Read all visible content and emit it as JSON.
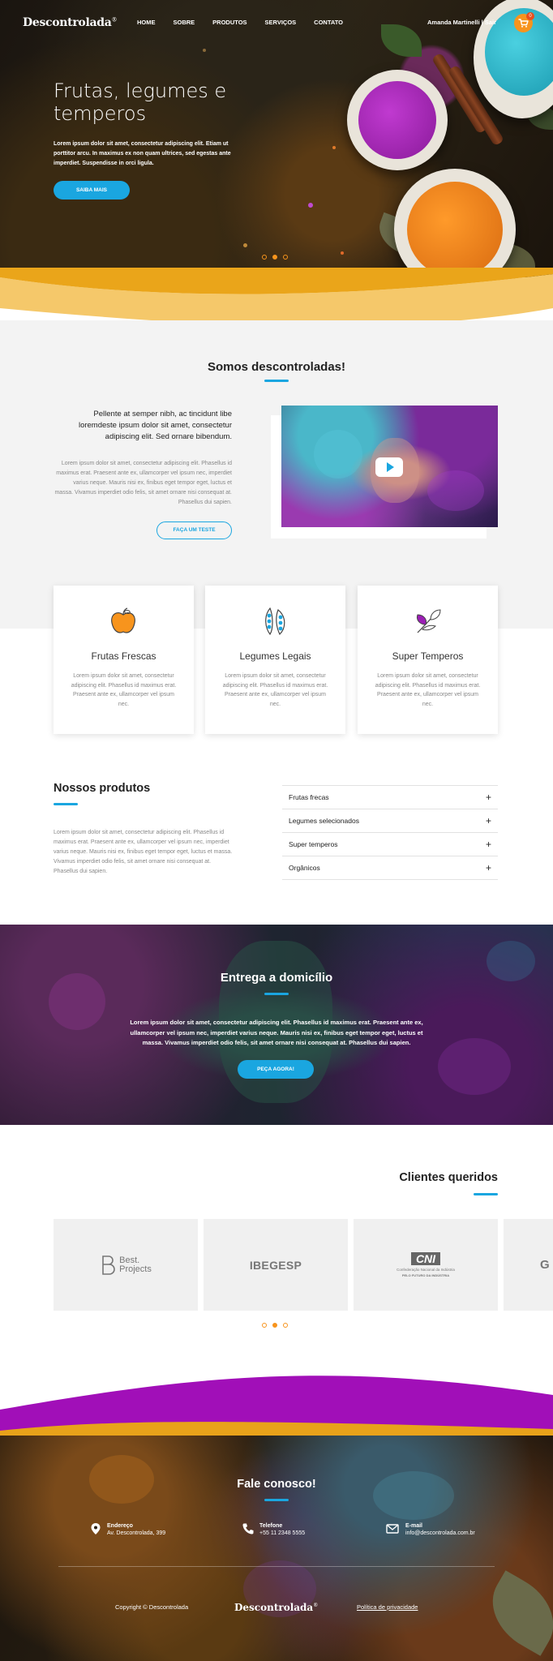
{
  "brand": {
    "logo": "Descontrolada",
    "logo_mark": "®"
  },
  "nav": {
    "items": [
      "HOME",
      "SOBRE",
      "PRODUTOS",
      "SERVIÇOS",
      "CONTATO"
    ]
  },
  "header": {
    "user_text": "Amanda Martinelli  |  Sair",
    "cart_count": "0"
  },
  "hero": {
    "title": "Frutas, legumes e temperos",
    "text": "Lorem ipsum dolor sit amet, consectetur adipiscing elit. Etiam ut porttitor arcu. In maximus ex non quam ultrices, sed egestas ante imperdiet. Suspendisse in orci ligula.",
    "button": "SAIBA MAIS",
    "slider": {
      "count": 3,
      "active": 2
    }
  },
  "about": {
    "title": "Somos descontroladas!",
    "lead": "Pellente at semper nibh, ac tincidunt libe loremdeste ipsum dolor sit amet, consectetur adipiscing elit. Sed ornare bibendum.",
    "body": "Lorem ipsum dolor sit amet, consectetur adipiscing elit. Phasellus id maximus erat. Praesent ante ex, ullamcorper vel ipsum nec, imperdiet varius neque. Mauris nisi ex, finibus eget tempor eget, luctus et massa. Vivamus imperdiet odio felis, sit amet ornare nisi consequat at. Phasellus dui sapien.",
    "button": "FAÇA UM TESTE"
  },
  "features": [
    {
      "icon": "apple-icon",
      "title": "Frutas Frescas",
      "text": "Lorem ipsum dolor sit amet, consectetur adipiscing elit. Phasellus id maximus erat. Praesent ante ex, ullamcorper vel ipsum nec."
    },
    {
      "icon": "peapod-icon",
      "title": "Legumes Legais",
      "text": "Lorem ipsum dolor sit amet, consectetur adipiscing elit. Phasellus id maximus erat. Praesent ante ex, ullamcorper vel ipsum nec."
    },
    {
      "icon": "herb-icon",
      "title": "Super Temperos",
      "text": "Lorem ipsum dolor sit amet, consectetur adipiscing elit. Phasellus id maximus erat. Praesent ante ex, ullamcorper vel ipsum nec."
    }
  ],
  "products": {
    "title": "Nossos produtos",
    "body": "Lorem ipsum dolor sit amet, consectetur adipiscing elit. Phasellus id maximus erat. Praesent ante ex, ullamcorper vel ipsum nec, imperdiet varius neque. Mauris nisi ex, finibus eget tempor eget, luctus et massa. Vivamus imperdiet odio felis, sit amet ornare nisi consequat at. Phasellus dui sapien.",
    "accordion": [
      "Frutas frecas",
      "Legumes selecionados",
      "Super temperos",
      "Orgânicos"
    ]
  },
  "delivery": {
    "title": "Entrega a domicílio",
    "text": "Lorem ipsum dolor sit amet, consectetur adipiscing elit. Phasellus id maximus erat. Praesent ante ex, ullamcorper vel ipsum nec, imperdiet varius neque. Mauris nisi ex, finibus eget tempor eget, luctus et massa. Vivamus imperdiet odio felis, sit amet ornare nisi consequat at. Phasellus dui sapien.",
    "button": "PEÇA AGORA!"
  },
  "clients": {
    "title": "Clientes queridos",
    "logos": {
      "best_line1": "Best.",
      "best_line2": "Projects",
      "ibegesp": "IBEGESP",
      "cni": "CNI",
      "cni_sub1": "Confederação Nacional da Indústria",
      "cni_sub2": "PELO FUTURO DA INDÚSTRIA",
      "partial": "G"
    },
    "slider": {
      "count": 3,
      "active": 2
    }
  },
  "footer": {
    "title": "Fale conosco!",
    "contacts": [
      {
        "icon": "location-pin-icon",
        "label": "Endereço",
        "value": "Av. Descontrolada, 399"
      },
      {
        "icon": "phone-icon",
        "label": "Telefone",
        "value": "+55 11 2348 5555"
      },
      {
        "icon": "mail-icon",
        "label": "E-mail",
        "value": "info@descontrolada.com.br"
      }
    ],
    "copyright": "Copyright ©  Descontrolada",
    "logo": "Descontrolada",
    "logo_mark": "®",
    "privacy": "Política de privacidade"
  },
  "colors": {
    "accent": "#1aa6e0",
    "orange": "#f7941d",
    "wave_yellow": "#f2b233",
    "wave_purple": "#a10fb8"
  }
}
